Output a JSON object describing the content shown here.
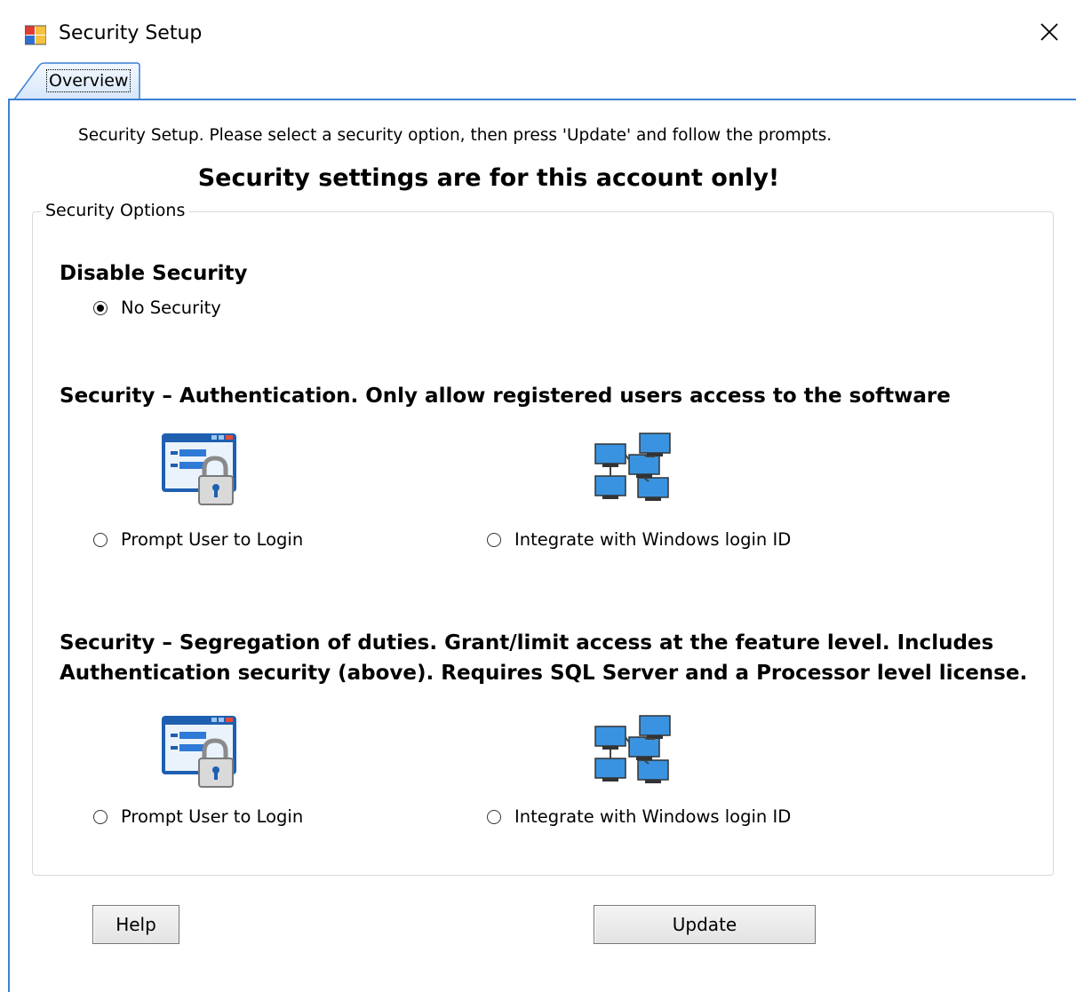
{
  "window": {
    "title": "Security Setup",
    "close_glyph": "✕"
  },
  "tabs": [
    {
      "label": "Overview",
      "selected": true
    }
  ],
  "overview": {
    "instructions": "Security Setup.  Please select a security option, then press 'Update' and follow the prompts.",
    "warning": "Security settings are for this account only!",
    "group_label": "Security Options",
    "disable_section": {
      "title": "Disable Security",
      "option_label": "No Security",
      "selected": true
    },
    "auth_section": {
      "title": "Security – Authentication.  Only allow registered users access to the software",
      "options": [
        {
          "label": "Prompt User to Login",
          "icon": "login-window-lock-icon",
          "selected": false
        },
        {
          "label": "Integrate with Windows login ID",
          "icon": "network-computers-icon",
          "selected": false
        }
      ]
    },
    "segregation_section": {
      "title_line1": "Security – Segregation of duties. Grant/limit access at the feature level.  Includes",
      "title_line2": "Authentication security (above). Requires SQL Server and a Processor level license.",
      "options": [
        {
          "label": "Prompt User to Login",
          "icon": "login-window-lock-icon",
          "selected": false
        },
        {
          "label": "Integrate with Windows login ID",
          "icon": "network-computers-icon",
          "selected": false
        }
      ]
    },
    "buttons": {
      "help": "Help",
      "update": "Update"
    }
  },
  "colors": {
    "accent_border": "#3c7fd4",
    "tab_fill": "#dbe9fb"
  }
}
